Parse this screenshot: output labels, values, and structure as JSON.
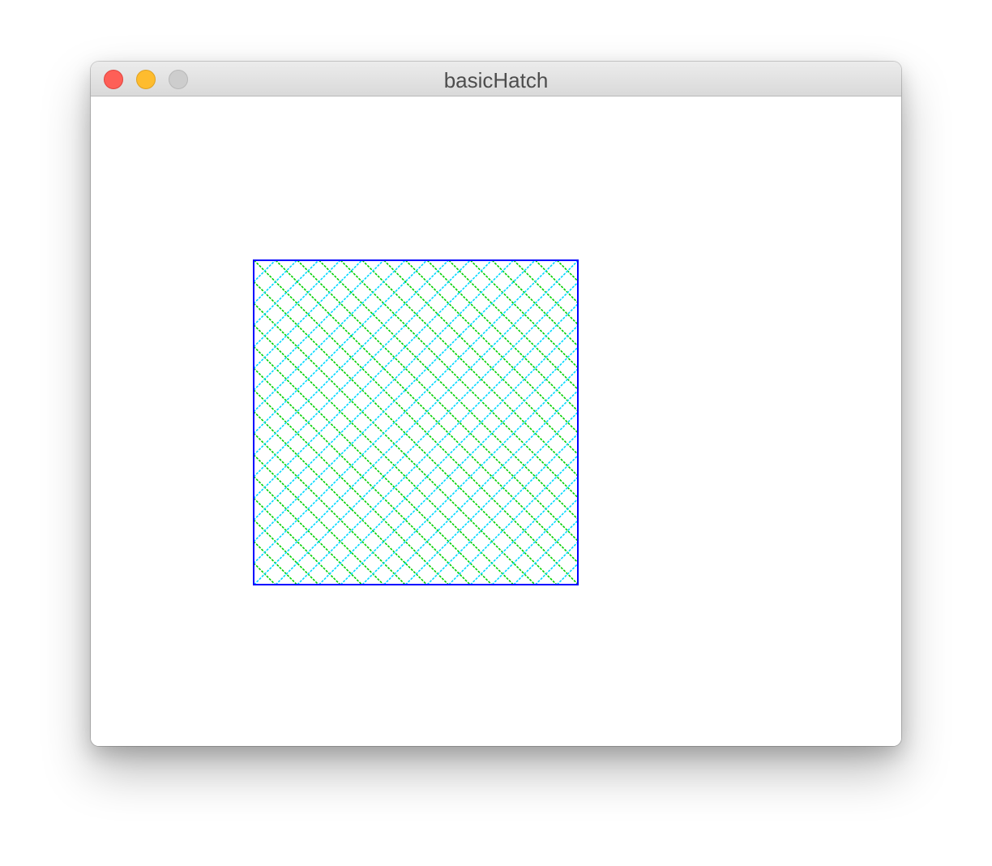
{
  "window": {
    "title": "basicHatch"
  },
  "hatch": {
    "outline_color": "#0000ff",
    "line_color_1": "#00d000",
    "line_color_2": "#00d8ff"
  }
}
